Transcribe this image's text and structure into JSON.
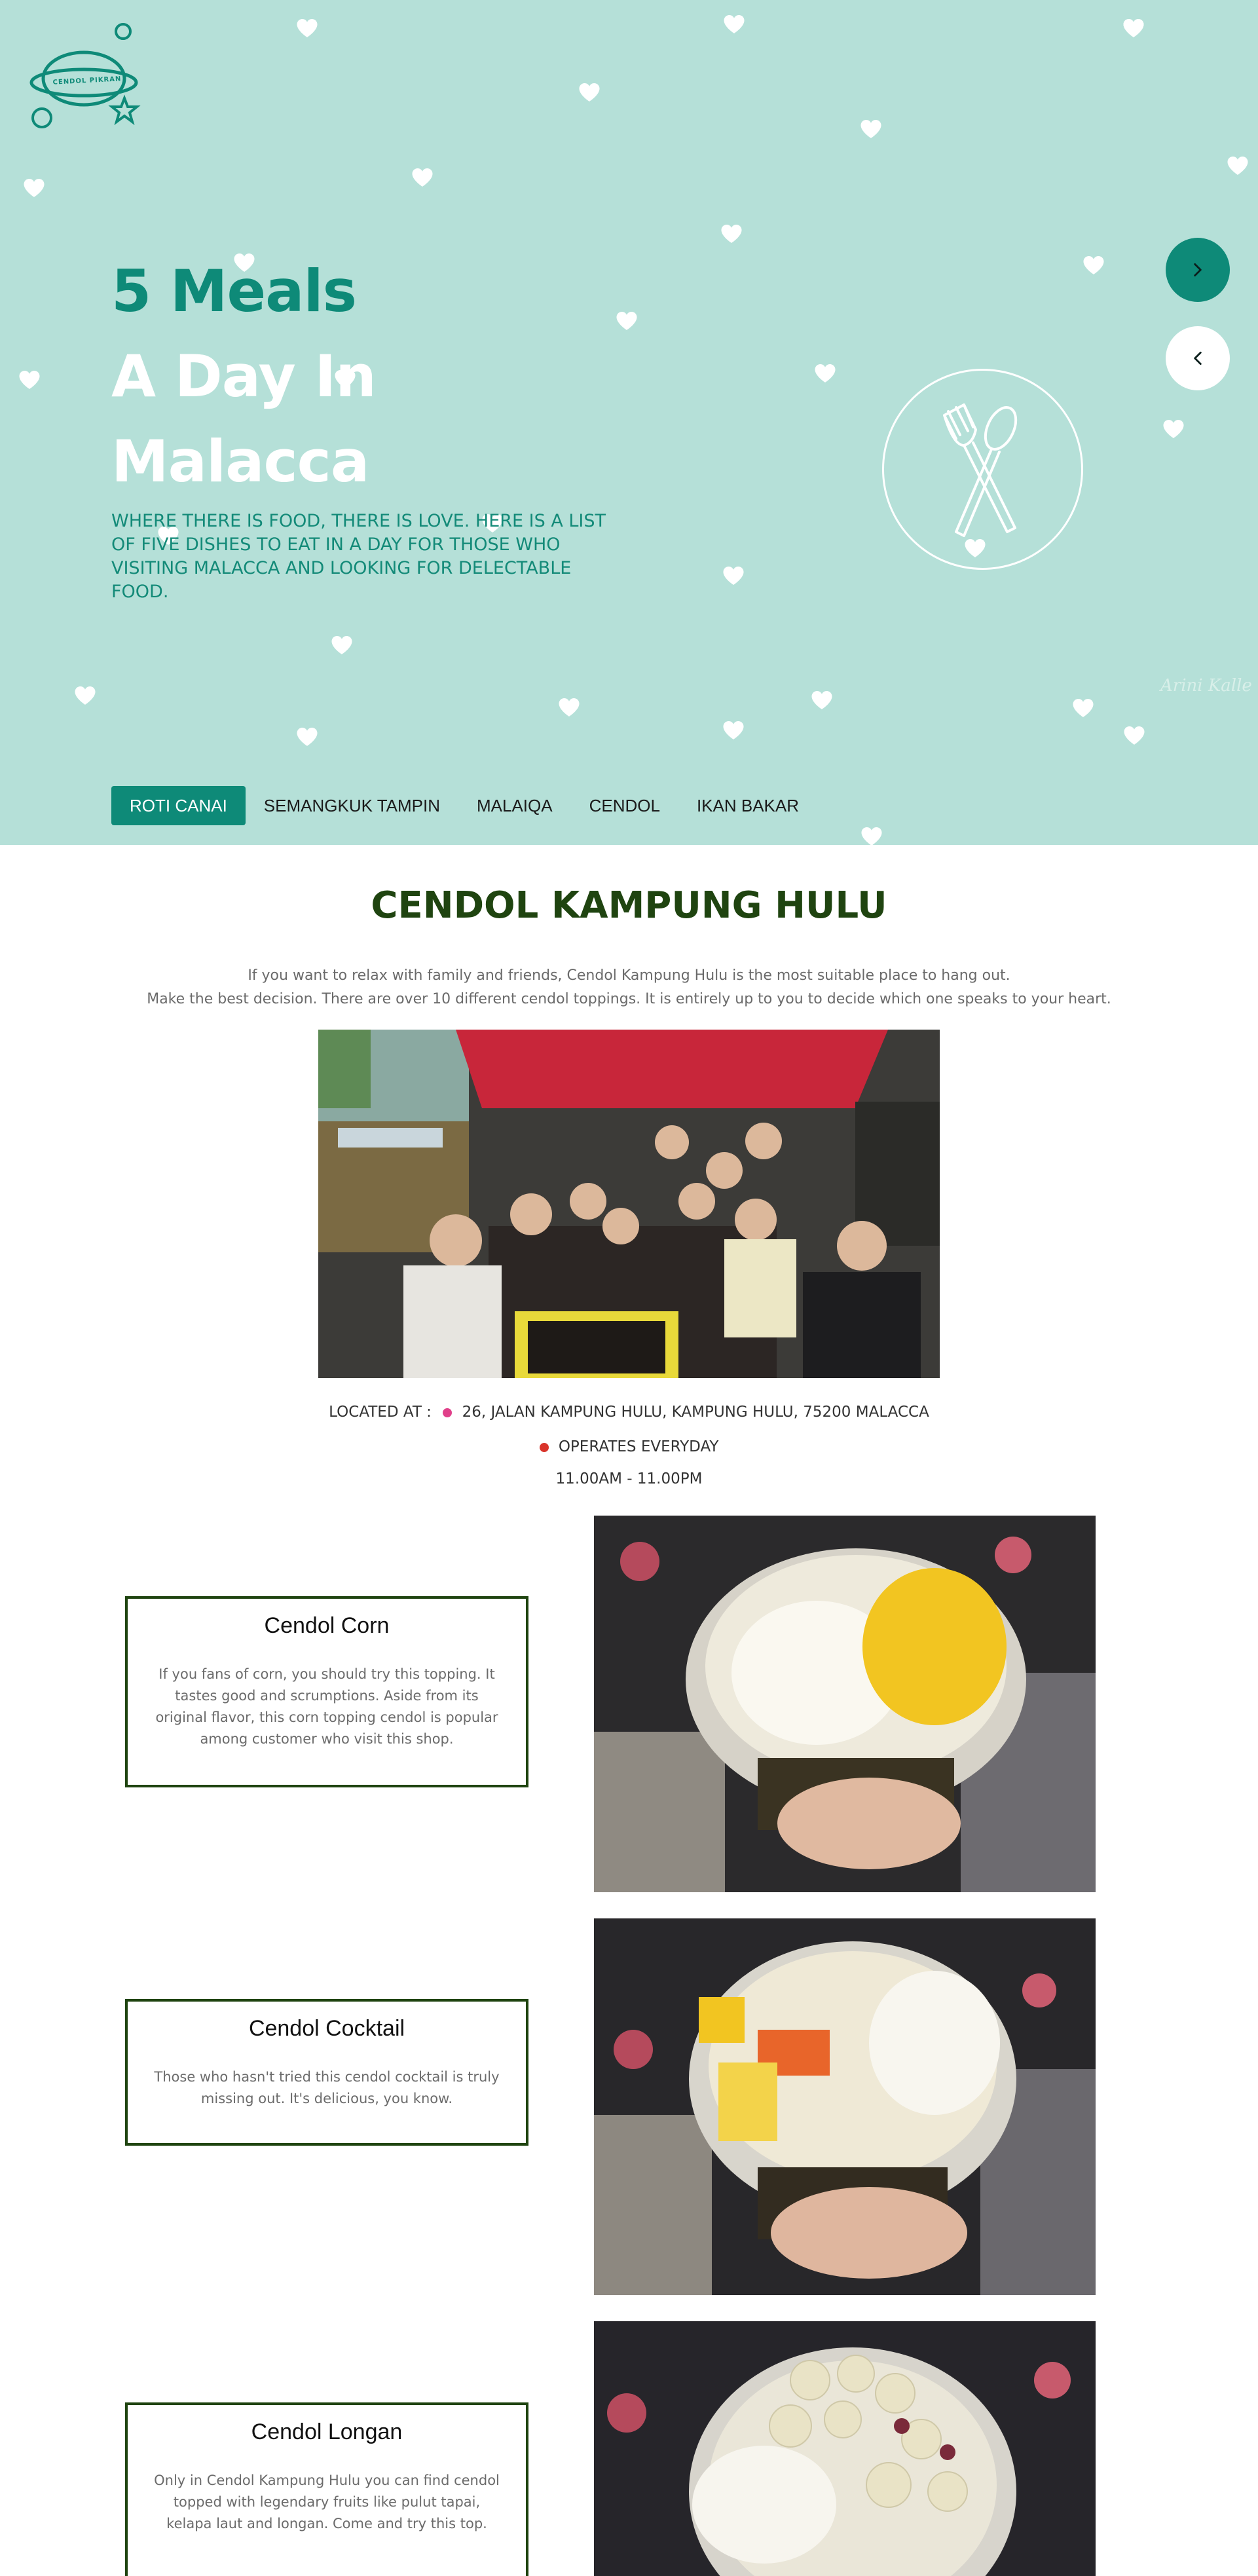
{
  "hero": {
    "logo_text": "CENDOL PIKRAN",
    "title_line1": "5 Meals",
    "title_line2": "A Day In",
    "title_line3": "Malacca",
    "subtitle": "WHERE THERE IS FOOD, THERE IS LOVE. HERE IS A LIST OF FIVE DISHES TO EAT IN A DAY FOR THOSE WHO VISITING MALACCA AND LOOKING FOR DELECTABLE FOOD.",
    "credit": "Arini Kalle"
  },
  "tabs": [
    {
      "label": "ROTI CANAI",
      "active": true
    },
    {
      "label": "SEMANGKUK TAMPIN",
      "active": false
    },
    {
      "label": "MALAIQA",
      "active": false
    },
    {
      "label": "CENDOL",
      "active": false
    },
    {
      "label": "IKAN BAKAR",
      "active": false
    }
  ],
  "section": {
    "title": "CENDOL KAMPUNG HULU",
    "intro_line1": "If you want to relax with family and friends, Cendol Kampung Hulu is the most suitable place to hang out.",
    "intro_line2": "Make the best decision. There are over 10 different cendol toppings. It is entirely up to you to decide which one speaks to your heart.",
    "location_label": "LOCATED AT :",
    "location_address": "26, JALAN KAMPUNG HULU, KAMPUNG HULU, 75200 MALACCA",
    "operates": "OPERATES EVERYDAY",
    "hours": "11.00AM - 11.00PM"
  },
  "items": [
    {
      "name": "Cendol Corn",
      "desc": "If you fans of corn, you should try this topping. It tastes good and scrumptions. Aside from its original flavor, this corn topping cendol is popular among customer who visit this shop."
    },
    {
      "name": "Cendol Cocktail",
      "desc": "Those who hasn't tried this cendol cocktail is truly missing out. It's delicious, you know."
    },
    {
      "name": "Cendol Longan",
      "desc": "Only in Cendol Kampung Hulu you can find cendol topped with legendary fruits like pulut tapai, kelapa laut and longan. Come and try this top."
    }
  ],
  "colors": {
    "hero_bg": "#b5e0d8",
    "accent": "#0e8a78",
    "title_green": "#1f4410",
    "pin_pink": "#e0408a",
    "pin_red": "#d9342b"
  },
  "icons": {
    "next": "chevron-right-icon",
    "prev": "chevron-left-icon",
    "utensils": "fork-spoon-icon",
    "heart": "heart-icon",
    "pin": "pushpin-icon"
  }
}
